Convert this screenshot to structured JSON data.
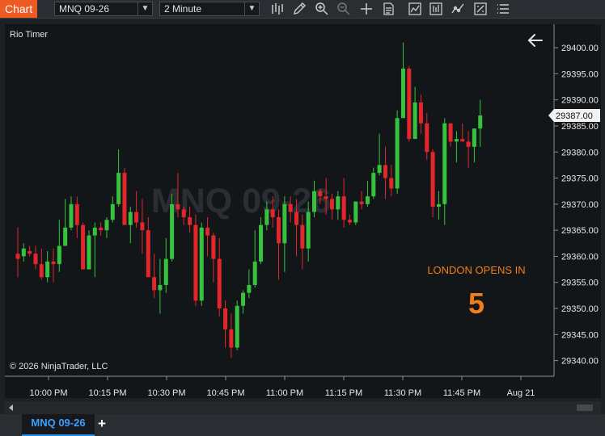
{
  "toolbar": {
    "chart_tab": "Chart",
    "instrument": "MNQ 09-26",
    "interval": "2 Minute",
    "icons": [
      "bar-type-icon",
      "draw-pencil-icon",
      "zoom-in-icon",
      "zoom-out-icon",
      "crosshair-icon",
      "data-box-icon",
      "indicators-icon",
      "strategies-icon",
      "drawing-tools-icon",
      "properties-icon",
      "more-menu-icon"
    ]
  },
  "chart": {
    "indicator_label": "Rio Timer",
    "watermark": "MNQ 09-26",
    "copyright": "© 2026 NinjaTrader, LLC",
    "timer_label": "LONDON OPENS IN",
    "timer_value": "5",
    "back_icon": "arrow-left-icon",
    "current_price_label": "29387.00",
    "colors": {
      "up": "#36c23e",
      "down": "#e3262b",
      "timer": "#ef7f1a",
      "background": "#131619"
    }
  },
  "chart_data": {
    "type": "candlestick",
    "symbol": "MNQ 09-26",
    "interval": "2 Minute",
    "y_ticks": [
      "29400.00",
      "29395.00",
      "29390.00",
      "29385.00",
      "29380.00",
      "29375.00",
      "29370.00",
      "29365.00",
      "29360.00",
      "29355.00",
      "29350.00",
      "29345.00",
      "29340.00"
    ],
    "ylim": [
      29337.0,
      29404.5
    ],
    "x_ticks": [
      "10:00 PM",
      "10:15 PM",
      "10:30 PM",
      "10:45 PM",
      "11:00 PM",
      "11:15 PM",
      "11:30 PM",
      "11:45 PM",
      "Aug 21"
    ],
    "last_price": 29387.0,
    "candles": [
      [
        29360.5,
        29359.5,
        29365.5,
        29356.0
      ],
      [
        29360.0,
        29361.5,
        29362.5,
        29359.0
      ],
      [
        29361.0,
        29360.5,
        29362.0,
        29360.0
      ],
      [
        29360.5,
        29358.5,
        29362.0,
        29357.5
      ],
      [
        29358.5,
        29356.0,
        29361.5,
        29355.5
      ],
      [
        29356.0,
        29359.0,
        29361.0,
        29355.0
      ],
      [
        29359.0,
        29358.5,
        29361.5,
        29355.0
      ],
      [
        29358.5,
        29362.0,
        29367.0,
        29357.0
      ],
      [
        29362.0,
        29365.5,
        29371.0,
        29362.0
      ],
      [
        29365.5,
        29370.0,
        29371.5,
        29365.0
      ],
      [
        29370.0,
        29366.0,
        29371.5,
        29363.5
      ],
      [
        29366.0,
        29357.5,
        29366.5,
        29357.5
      ],
      [
        29357.5,
        29364.0,
        29365.0,
        29357.5
      ],
      [
        29364.0,
        29365.5,
        29366.5,
        29356.0
      ],
      [
        29365.5,
        29365.0,
        29366.5,
        29364.0
      ],
      [
        29365.0,
        29367.0,
        29367.5,
        29363.5
      ],
      [
        29367.0,
        29370.0,
        29371.5,
        29366.5
      ],
      [
        29370.0,
        29376.0,
        29380.5,
        29369.5
      ],
      [
        29376.0,
        29366.0,
        29377.0,
        29366.0
      ],
      [
        29366.0,
        29368.5,
        29369.5,
        29362.5
      ],
      [
        29368.5,
        29366.5,
        29372.5,
        29365.5
      ],
      [
        29366.5,
        29365.0,
        29371.0,
        29360.5
      ],
      [
        29365.0,
        29356.0,
        29367.5,
        29356.0
      ],
      [
        29356.0,
        29353.5,
        29360.5,
        29352.0
      ],
      [
        29353.5,
        29354.5,
        29359.5,
        29349.0
      ],
      [
        29354.5,
        29359.5,
        29363.5,
        29353.0
      ],
      [
        29359.5,
        29370.0,
        29372.0,
        29359.0
      ],
      [
        29370.0,
        29369.0,
        29376.0,
        29367.5
      ],
      [
        29369.0,
        29367.5,
        29369.5,
        29366.0
      ],
      [
        29367.5,
        29366.0,
        29369.5,
        29364.5
      ],
      [
        29366.0,
        29351.5,
        29368.0,
        29350.5
      ],
      [
        29351.5,
        29365.5,
        29366.5,
        29350.5
      ],
      [
        29365.5,
        29364.0,
        29367.5,
        29360.0
      ],
      [
        29364.0,
        29359.5,
        29364.5,
        29355.0
      ],
      [
        29359.5,
        29350.0,
        29363.5,
        29348.5
      ],
      [
        29350.0,
        29346.0,
        29351.5,
        29342.5
      ],
      [
        29346.0,
        29342.5,
        29349.0,
        29340.5
      ],
      [
        29342.5,
        29350.5,
        29351.5,
        29342.0
      ],
      [
        29350.5,
        29353.0,
        29353.5,
        29349.0
      ],
      [
        29353.0,
        29354.5,
        29357.5,
        29352.0
      ],
      [
        29354.5,
        29359.0,
        29365.0,
        29354.0
      ],
      [
        29359.0,
        29366.0,
        29367.5,
        29358.5
      ],
      [
        29366.0,
        29369.0,
        29370.5,
        29365.0
      ],
      [
        29369.0,
        29367.5,
        29371.5,
        29365.5
      ],
      [
        29367.5,
        29362.5,
        29369.0,
        29355.5
      ],
      [
        29362.5,
        29370.0,
        29371.5,
        29357.0
      ],
      [
        29370.0,
        29368.5,
        29371.5,
        29366.5
      ],
      [
        29368.5,
        29366.0,
        29371.0,
        29360.0
      ],
      [
        29366.0,
        29361.5,
        29368.0,
        29357.5
      ],
      [
        29361.5,
        29368.5,
        29370.5,
        29359.0
      ],
      [
        29368.5,
        29372.5,
        29374.5,
        29367.5
      ],
      [
        29372.5,
        29371.5,
        29373.0,
        29370.0
      ],
      [
        29371.5,
        29371.0,
        29375.0,
        29368.0
      ],
      [
        29371.0,
        29369.0,
        29372.0,
        29367.0
      ],
      [
        29369.0,
        29371.5,
        29372.5,
        29367.0
      ],
      [
        29371.5,
        29367.0,
        29375.0,
        29365.5
      ],
      [
        29367.0,
        29366.5,
        29368.0,
        29366.0
      ],
      [
        29366.5,
        29370.5,
        29370.5,
        29366.0
      ],
      [
        29370.5,
        29370.0,
        29372.5,
        29369.0
      ],
      [
        29370.0,
        29371.5,
        29374.5,
        29369.5
      ],
      [
        29371.5,
        29376.0,
        29377.0,
        29371.0
      ],
      [
        29376.0,
        29377.5,
        29383.5,
        29375.5
      ],
      [
        29377.5,
        29375.0,
        29381.0,
        29371.0
      ],
      [
        29375.0,
        29373.0,
        29377.5,
        29371.5
      ],
      [
        29373.0,
        29386.5,
        29388.0,
        29372.0
      ],
      [
        29386.5,
        29396.0,
        29401.0,
        29386.5
      ],
      [
        29396.0,
        29382.5,
        29396.5,
        29382.0
      ],
      [
        29382.5,
        29389.5,
        29392.5,
        29385.0
      ],
      [
        29389.5,
        29385.5,
        29391.0,
        29383.5
      ],
      [
        29385.5,
        29380.0,
        29387.5,
        29378.5
      ],
      [
        29380.0,
        29369.5,
        29380.5,
        29367.5
      ],
      [
        29369.5,
        29370.0,
        29372.5,
        29367.0
      ],
      [
        29370.0,
        29385.5,
        29386.5,
        29366.0
      ],
      [
        29385.5,
        29382.0,
        29385.5,
        29381.0
      ],
      [
        29382.0,
        29382.5,
        29384.0,
        29378.0
      ],
      [
        29382.5,
        29382.0,
        29385.5,
        29382.0
      ],
      [
        29382.0,
        29381.0,
        29384.0,
        29377.0
      ],
      [
        29381.0,
        29384.5,
        29384.5,
        29378.0
      ],
      [
        29384.5,
        29387.0,
        29390.0,
        29381.0
      ]
    ]
  },
  "bottom": {
    "tab_label": "MNQ 09-26",
    "add_label": "+"
  }
}
